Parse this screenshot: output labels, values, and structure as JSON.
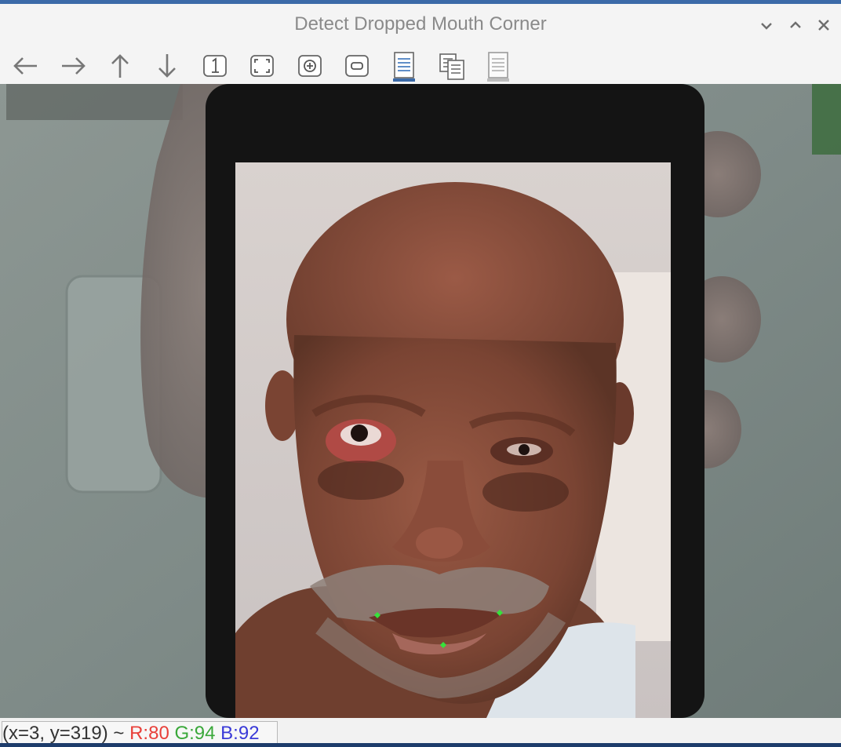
{
  "window": {
    "title": "Detect Dropped Mouth Corner",
    "controls": {
      "minimize": "⌄",
      "maximize": "⌃",
      "close": "✕"
    }
  },
  "toolbar": {
    "buttons": [
      {
        "name": "pan-left",
        "icon": "arrow-left-icon"
      },
      {
        "name": "pan-right",
        "icon": "arrow-right-icon"
      },
      {
        "name": "pan-up",
        "icon": "arrow-up-icon"
      },
      {
        "name": "pan-down",
        "icon": "arrow-down-icon"
      },
      {
        "name": "zoom-original",
        "icon": "zoom-1to1-icon",
        "glyph": "1"
      },
      {
        "name": "zoom-fit",
        "icon": "fit-window-icon"
      },
      {
        "name": "zoom-in",
        "icon": "zoom-in-icon"
      },
      {
        "name": "zoom-out",
        "icon": "zoom-out-icon"
      },
      {
        "name": "save-image",
        "icon": "save-image-icon"
      },
      {
        "name": "copy-image",
        "icon": "copy-image-icon"
      },
      {
        "name": "properties",
        "icon": "properties-icon"
      }
    ]
  },
  "status": {
    "coords": "(x=3, y=319) ~ ",
    "r": "R:80",
    "g": "G:94",
    "b": "B:92"
  },
  "colors": {
    "r_text": "#e8403a",
    "g_text": "#3aa83a",
    "b_text": "#3a3ad8",
    "landmark": "#36e23a",
    "accent": "#3b6aa8"
  },
  "landmarks": [
    {
      "label": "left-mouth-corner"
    },
    {
      "label": "right-mouth-corner"
    },
    {
      "label": "lower-lip-center"
    }
  ]
}
